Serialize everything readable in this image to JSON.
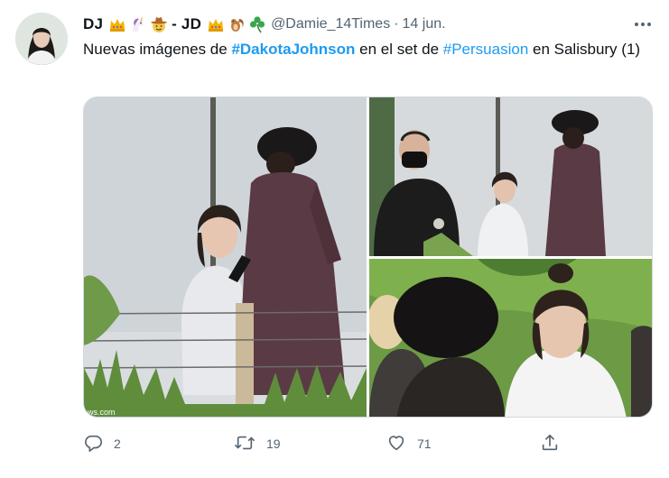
{
  "tweet": {
    "display_name_start": "DJ",
    "display_name_mid": "- JD",
    "handle": "@Damie_14Times",
    "separator": "·",
    "time": "14 jun.",
    "text_part1": "Nuevas imágenes de ",
    "hashtag1": "#DakotaJohnson",
    "text_part2": " en el set de ",
    "hashtag2": "#Persuasion",
    "text_part3": " en Salisbury (1)",
    "watermark": "ws.com"
  },
  "actions": {
    "reply_count": "2",
    "retweet_count": "19",
    "like_count": "71"
  },
  "icons": {
    "crown": "crown-emoji",
    "unicorn": "unicorn-emoji",
    "cowboy": "cowboy-emoji",
    "squirrel": "chipmunk-emoji",
    "shamrock": "shamrock-emoji",
    "more": "more-icon",
    "reply": "reply-icon",
    "retweet": "retweet-icon",
    "like": "heart-icon",
    "share": "share-icon"
  },
  "colors": {
    "accent": "#1d9bf0",
    "secondary_text": "#536471",
    "primary_text": "#0f1419",
    "border": "#cfd9de"
  }
}
